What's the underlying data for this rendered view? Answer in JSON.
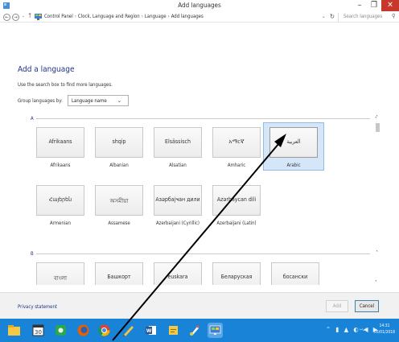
{
  "window": {
    "title": "Add languages",
    "controls": {
      "minimize": "–",
      "maximize": "❐",
      "close": "✕"
    }
  },
  "addressbar": {
    "back": "←",
    "forward": "→",
    "recent": "⌄",
    "up": "↑",
    "breadcrumb": [
      "Control Panel",
      "Clock, Language and Region",
      "Language",
      "Add languages"
    ],
    "separator": "›",
    "dropdown": "⌄",
    "refresh": "↻",
    "search_placeholder": "Search languages",
    "search_icon": "⚲"
  },
  "page": {
    "title": "Add a language",
    "hint": "Use the search box to find more languages.",
    "group_label": "Group languages by:",
    "group_value": "Language name",
    "group_chevron": "⌄"
  },
  "sections": [
    {
      "letter": "A",
      "up": "˄"
    },
    {
      "letter": "B",
      "up": "˄"
    }
  ],
  "languages": [
    {
      "native": "Afrikaans",
      "english": "Afrikaans",
      "selected": false
    },
    {
      "native": "shqip",
      "english": "Albanian",
      "selected": false
    },
    {
      "native": "Elsässisch",
      "english": "Alsatian",
      "selected": false
    },
    {
      "native": "አማርኛ",
      "english": "Amharic",
      "selected": false
    },
    {
      "native": "العربية",
      "english": "Arabic",
      "selected": true
    },
    {
      "native": "Հայերեն",
      "english": "Armenian",
      "selected": false
    },
    {
      "native": "অসমীয়া",
      "english": "Assamese",
      "selected": false
    },
    {
      "native": "Азәрбајҹан дили",
      "english": "Azerbaijani (Cyrillic)",
      "selected": false
    },
    {
      "native": "Azərbaycan dili",
      "english": "Azerbaijani (Latin)",
      "selected": false
    },
    {
      "native": "বাংলা",
      "english": "",
      "selected": false
    },
    {
      "native": "Башкорт",
      "english": "",
      "selected": false
    },
    {
      "native": "euskara",
      "english": "",
      "selected": false
    },
    {
      "native": "Беларуская",
      "english": "",
      "selected": false
    },
    {
      "native": "босански",
      "english": "",
      "selected": false
    }
  ],
  "scrollbar": {
    "up": "˄",
    "down": "˅"
  },
  "footer": {
    "privacy": "Privacy statement",
    "add": "Add",
    "cancel": "Cancel"
  },
  "taskbar": {
    "apps": [
      "file-explorer-icon",
      "calendar-icon",
      "green-app-icon",
      "firefox-icon",
      "chrome-icon",
      "paint-icon",
      "word-icon",
      "notes-icon",
      "paint-brush-icon",
      "control-panel-icon"
    ],
    "tray": "⌃ ▮ ▲ ◐ ◀ ▶",
    "input_language": "عرب",
    "time": "14:31",
    "date": "05/01/2018"
  },
  "colors": {
    "accent_blue": "#1e3287",
    "selected_bg": "#d4e6f7",
    "close_red": "#c7372c",
    "taskbar_blue": "#1883d7"
  }
}
